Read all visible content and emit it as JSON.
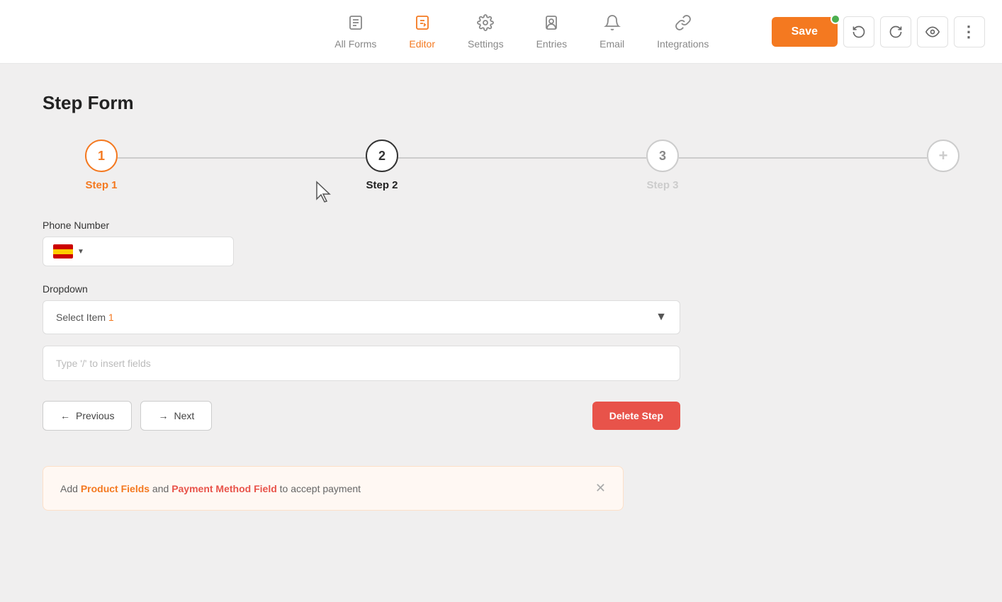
{
  "header": {
    "tabs": [
      {
        "id": "all-forms",
        "label": "All Forms",
        "icon": "📋",
        "active": false
      },
      {
        "id": "editor",
        "label": "Editor",
        "icon": "✏️",
        "active": true
      },
      {
        "id": "settings",
        "label": "Settings",
        "icon": "⚙️",
        "active": false
      },
      {
        "id": "entries",
        "label": "Entries",
        "icon": "👤",
        "active": false
      },
      {
        "id": "email",
        "label": "Email",
        "icon": "🔔",
        "active": false
      },
      {
        "id": "integrations",
        "label": "Integrations",
        "icon": "🔗",
        "active": false
      }
    ],
    "save_label": "Save",
    "undo_label": "↺",
    "redo_label": "↻",
    "preview_label": "👁"
  },
  "page": {
    "title": "Step Form"
  },
  "wizard": {
    "steps": [
      {
        "number": "1",
        "label": "Step 1",
        "state": "active"
      },
      {
        "number": "2",
        "label": "Step 2",
        "state": "done"
      },
      {
        "number": "3",
        "label": "Step 3",
        "state": "inactive"
      }
    ],
    "add_label": "+"
  },
  "form": {
    "phone_label": "Phone Number",
    "phone_placeholder": "",
    "dropdown_label": "Dropdown",
    "dropdown_placeholder": "Select Item 1",
    "insert_placeholder": "Type '/' to insert fields"
  },
  "buttons": {
    "previous": "Previous",
    "next": "Next",
    "delete_step": "Delete Step"
  },
  "payment_notice": {
    "text_prefix": "Add ",
    "product_fields": "Product Fields",
    "and": " and ",
    "payment_field": "Payment Method Field",
    "text_suffix": " to accept payment"
  }
}
